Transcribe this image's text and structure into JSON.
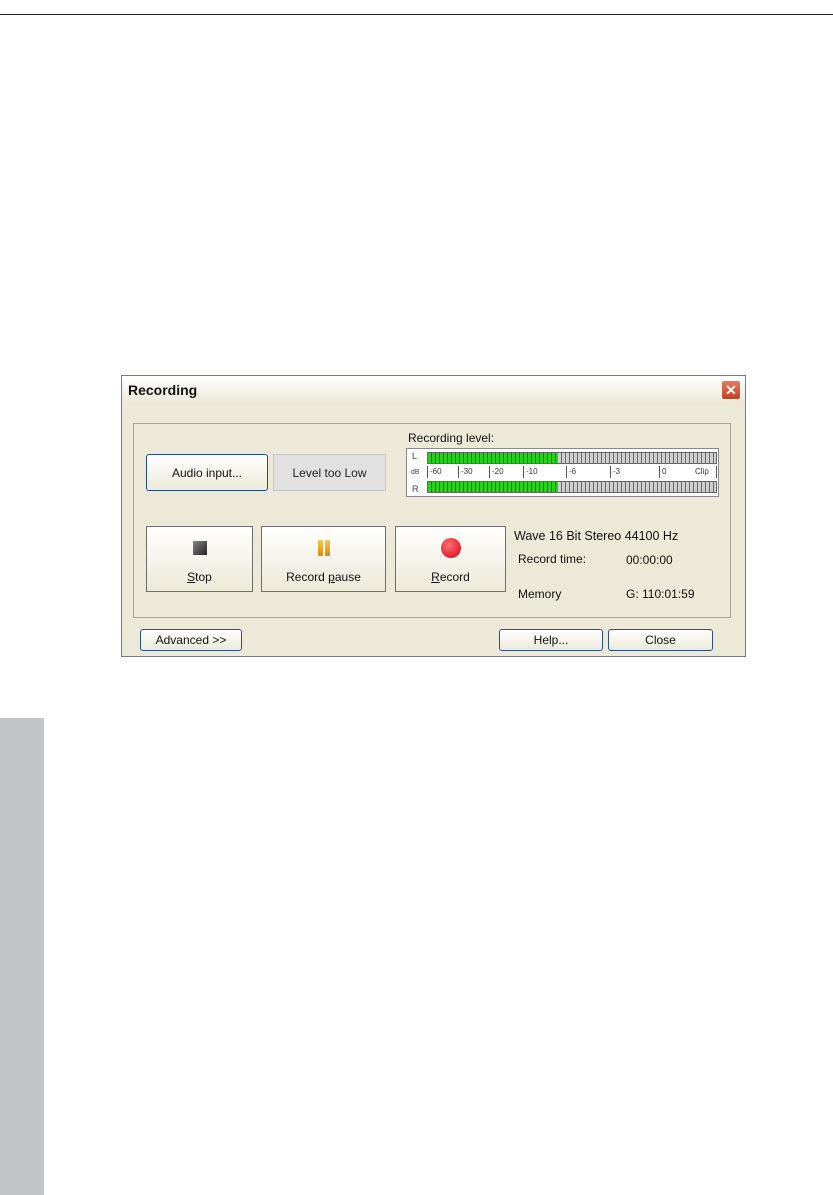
{
  "dialog": {
    "title": "Recording",
    "close_glyph": "✕",
    "audio_input_label": "Audio input...",
    "level_status": "Level too Low",
    "recording_level_label": "Recording level:",
    "meter": {
      "left_channel": "L",
      "right_channel": "R",
      "unit": "dB",
      "scale": [
        "-60",
        "-30",
        "-20",
        "-10",
        "-6",
        "-3",
        "0",
        "Clip"
      ],
      "left_level_fraction": 0.45,
      "right_level_fraction": 0.45
    },
    "buttons": {
      "stop": "Stop",
      "record_pause": "Record pause",
      "record": "Record",
      "advanced": "Advanced >>",
      "help": "Help...",
      "close": "Close"
    },
    "format": "Wave  16 Bit  Stereo  44100 Hz",
    "record_time_label": "Record time:",
    "record_time_value": "00:00:00",
    "memory_label": "Memory",
    "memory_value": "G: 110:01:59",
    "icons": {
      "stop": "stop-square-icon",
      "pause": "pause-icon",
      "record": "record-dot-icon"
    }
  }
}
